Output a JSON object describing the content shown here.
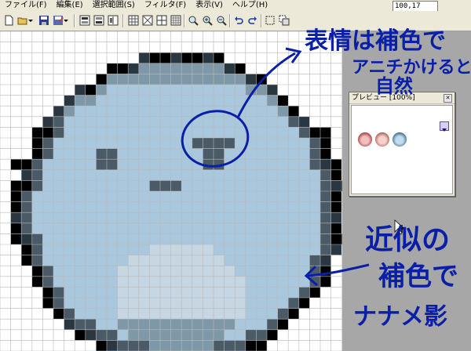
{
  "menu": [
    {
      "label": "ファイル(F)"
    },
    {
      "label": "編集(E)"
    },
    {
      "label": "選択範囲(S)"
    },
    {
      "label": "フィルタ(F)"
    },
    {
      "label": "表示(V)"
    },
    {
      "label": "ヘルプ(H)"
    }
  ],
  "status": {
    "cursor_position": "100,17"
  },
  "preview": {
    "title": "プレビュー [100%]"
  },
  "annotations": {
    "top_note_line1": "表情は補色で",
    "top_note_line2": "アニチかけると",
    "top_note_line3": "自然",
    "bottom_note_line1": "近似の",
    "bottom_note_line2": "補色で",
    "bottom_note_line3": "ナナメ影"
  },
  "palette": {
    "black": "#000000",
    "outline_dark": "#2a3640",
    "dark": "#4a5a66",
    "mid": "#7f98a8",
    "light": "#a9c8de",
    "pale": "#c6d6e2",
    "white": "#ffffff",
    "annotation_ink": "#0a1fa8"
  }
}
